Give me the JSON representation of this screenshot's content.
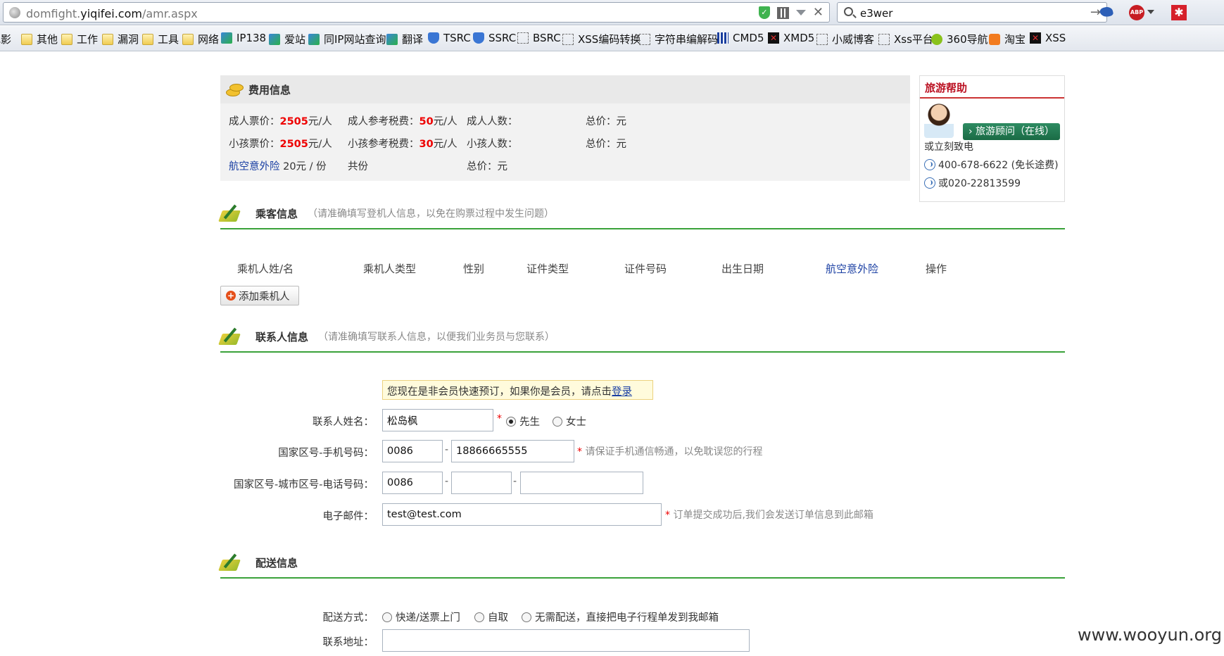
{
  "browser": {
    "url_prefix": "domfight.",
    "url_host": "yiqifei.com",
    "url_path": "/amr.aspx",
    "search_query": "e3wer",
    "addon_abp_label": "ABP"
  },
  "bookmarks": [
    {
      "label": "电影",
      "icon": "none"
    },
    {
      "label": "其他",
      "icon": "folder"
    },
    {
      "label": "工作",
      "icon": "folder"
    },
    {
      "label": "漏洞",
      "icon": "folder"
    },
    {
      "label": "工具",
      "icon": "folder"
    },
    {
      "label": "网络",
      "icon": "folder"
    },
    {
      "label": "IP138",
      "icon": "colored"
    },
    {
      "label": "爱站",
      "icon": "colored"
    },
    {
      "label": "同IP网站查询",
      "icon": "colored"
    },
    {
      "label": "翻译",
      "icon": "colored"
    },
    {
      "label": "TSRC",
      "icon": "shield"
    },
    {
      "label": "SSRC",
      "icon": "shield"
    },
    {
      "label": "BSRC",
      "icon": "dotted"
    },
    {
      "label": "XSS编码转换",
      "icon": "dotted"
    },
    {
      "label": "字符串编解码",
      "icon": "dotted"
    },
    {
      "label": "CMD5",
      "icon": "grid"
    },
    {
      "label": "XMD5",
      "icon": "black"
    },
    {
      "label": "小威博客",
      "icon": "dotted"
    },
    {
      "label": "Xss平台",
      "icon": "dotted"
    },
    {
      "label": "360导航",
      "icon": "yellowgreen"
    },
    {
      "label": "淘宝",
      "icon": "orange"
    },
    {
      "label": "XSS",
      "icon": "black"
    }
  ],
  "fee": {
    "title": "费用信息",
    "rows": [
      [
        {
          "label": "成人票价：",
          "value": "2505",
          "unit": "元/人"
        },
        {
          "label": "成人参考税费：",
          "value": "50",
          "unit": "元/人"
        },
        {
          "label": "成人人数：",
          "value": "",
          "unit": ""
        },
        {
          "label": "总价：",
          "value": "",
          "unit": "元"
        }
      ],
      [
        {
          "label": "小孩票价：",
          "value": "2505",
          "unit": "元/人"
        },
        {
          "label": "小孩参考税费：",
          "value": "30",
          "unit": "元/人"
        },
        {
          "label": "小孩人数：",
          "value": "",
          "unit": ""
        },
        {
          "label": "总价：",
          "value": "",
          "unit": "元"
        }
      ]
    ],
    "insurance_link": "航空意外险",
    "insurance_price": " 20元 / 份",
    "insurance_count": "共份",
    "insurance_total": "总价：元"
  },
  "help": {
    "title": "旅游帮助",
    "button": "› 旅游顾问（在线）",
    "call_text": "或立刻致电",
    "phone1": "400-678-6622 (免长途费)",
    "phone2": "或020-22813599"
  },
  "passenger": {
    "title": "乘客信息",
    "hint": "（请准确填写登机人信息，以免在购票过程中发生问题）",
    "columns": [
      "乘机人姓/名",
      "乘机人类型",
      "性别",
      "证件类型",
      "证件号码",
      "出生日期",
      "航空意外险",
      "操作"
    ],
    "add_button": "添加乘机人"
  },
  "contact": {
    "title": "联系人信息",
    "hint": "（请准确填写联系人信息，以便我们业务员与您联系）",
    "notice_text": "您现在是非会员快速预订，如果你是会员，请点击",
    "notice_link": "登录",
    "name_label": "联系人姓名：",
    "name_value": "松岛枫",
    "gender_male": "先生",
    "gender_female": "女士",
    "mobile_label": "国家区号-手机号码：",
    "mobile_country": "0086",
    "mobile_number": "18866665555",
    "mobile_hint": "请保证手机通信畅通，以免耽误您的行程",
    "phone_label": "国家区号-城市区号-电话号码：",
    "phone_country": "0086",
    "phone_city": "",
    "phone_number": "",
    "email_label": "电子邮件：",
    "email_value": "test@test.com",
    "email_hint": "订单提交成功后,我们会发送订单信息到此邮箱"
  },
  "delivery": {
    "title": "配送信息",
    "method_label": "配送方式：",
    "options": [
      "快递/送票上门",
      "自取",
      "无需配送，直接把电子行程单发到我邮箱"
    ],
    "address_label": "联系地址：",
    "address_value": ""
  },
  "watermark": "www.wooyun.org"
}
